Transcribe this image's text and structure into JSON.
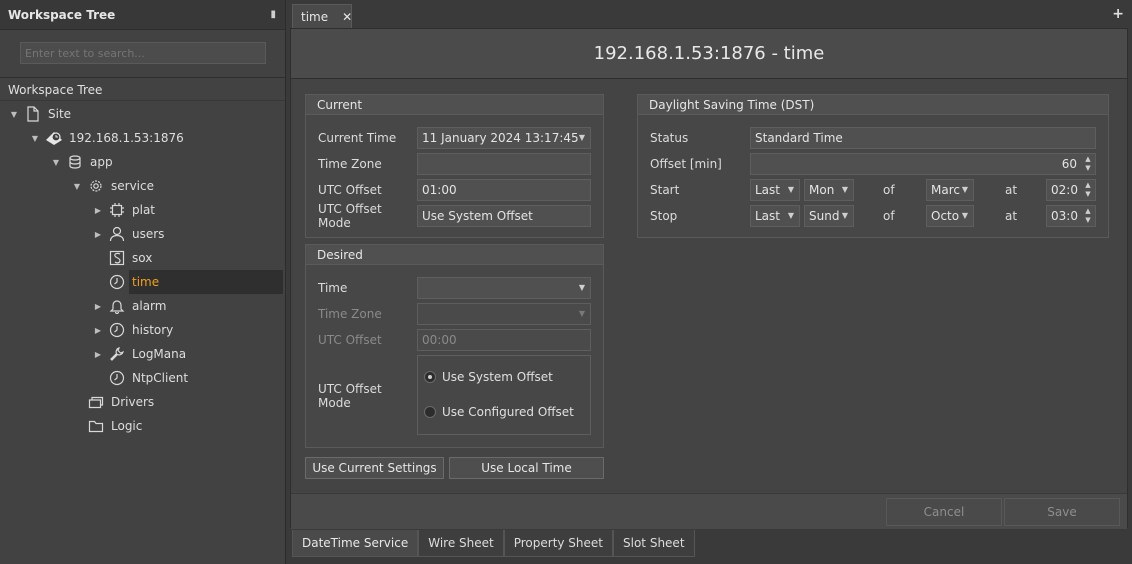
{
  "left_panel": {
    "title": "Workspace Tree",
    "search_placeholder": "Enter text to search...",
    "tree_title": "Workspace Tree",
    "nodes": {
      "site": "Site",
      "device": "192.168.1.53:1876",
      "app": "app",
      "service": "service",
      "plat": "plat",
      "users": "users",
      "sox": "sox",
      "time": "time",
      "alarm": "alarm",
      "history": "history",
      "logmana": "LogMana",
      "ntpclient": "NtpClient",
      "drivers": "Drivers",
      "logic": "Logic"
    }
  },
  "tab": {
    "label": "time",
    "close": "✕",
    "add": "+"
  },
  "page_title": "192.168.1.53:1876 - time",
  "current": {
    "title": "Current",
    "current_time_label": "Current Time",
    "current_time_value": "11 January 2024 13:17:45",
    "time_zone_label": "Time Zone",
    "time_zone_value": "",
    "utc_offset_label": "UTC Offset",
    "utc_offset_value": "01:00",
    "utc_offset_mode_label": "UTC Offset Mode",
    "utc_offset_mode_value": "Use System Offset"
  },
  "desired": {
    "title": "Desired",
    "time_label": "Time",
    "time_zone_label": "Time Zone",
    "utc_offset_label": "UTC Offset",
    "utc_offset_value": "00:00",
    "utc_offset_mode_label": "UTC Offset Mode",
    "radio_system": "Use System Offset",
    "radio_configured": "Use Configured Offset"
  },
  "buttons": {
    "use_current": "Use Current Settings",
    "use_local": "Use Local Time",
    "cancel": "Cancel",
    "save": "Save"
  },
  "dst": {
    "title": "Daylight Saving Time (DST)",
    "status_label": "Status",
    "status_value": "Standard Time",
    "offset_label": "Offset [min]",
    "offset_value": "60",
    "start_label": "Start",
    "stop_label": "Stop",
    "start_week": "Last",
    "start_day": "Mon",
    "start_month": "Marc",
    "start_time": "02:0",
    "stop_week": "Last",
    "stop_day": "Sund",
    "stop_month": "Octo",
    "stop_time": "03:0",
    "of": "of",
    "at": "at"
  },
  "bottom_tabs": {
    "datetime": "DateTime Service",
    "wire": "Wire Sheet",
    "property": "Property Sheet",
    "slot": "Slot Sheet"
  },
  "colors": {
    "selected_text": "#f0a020",
    "background": "#444444"
  }
}
